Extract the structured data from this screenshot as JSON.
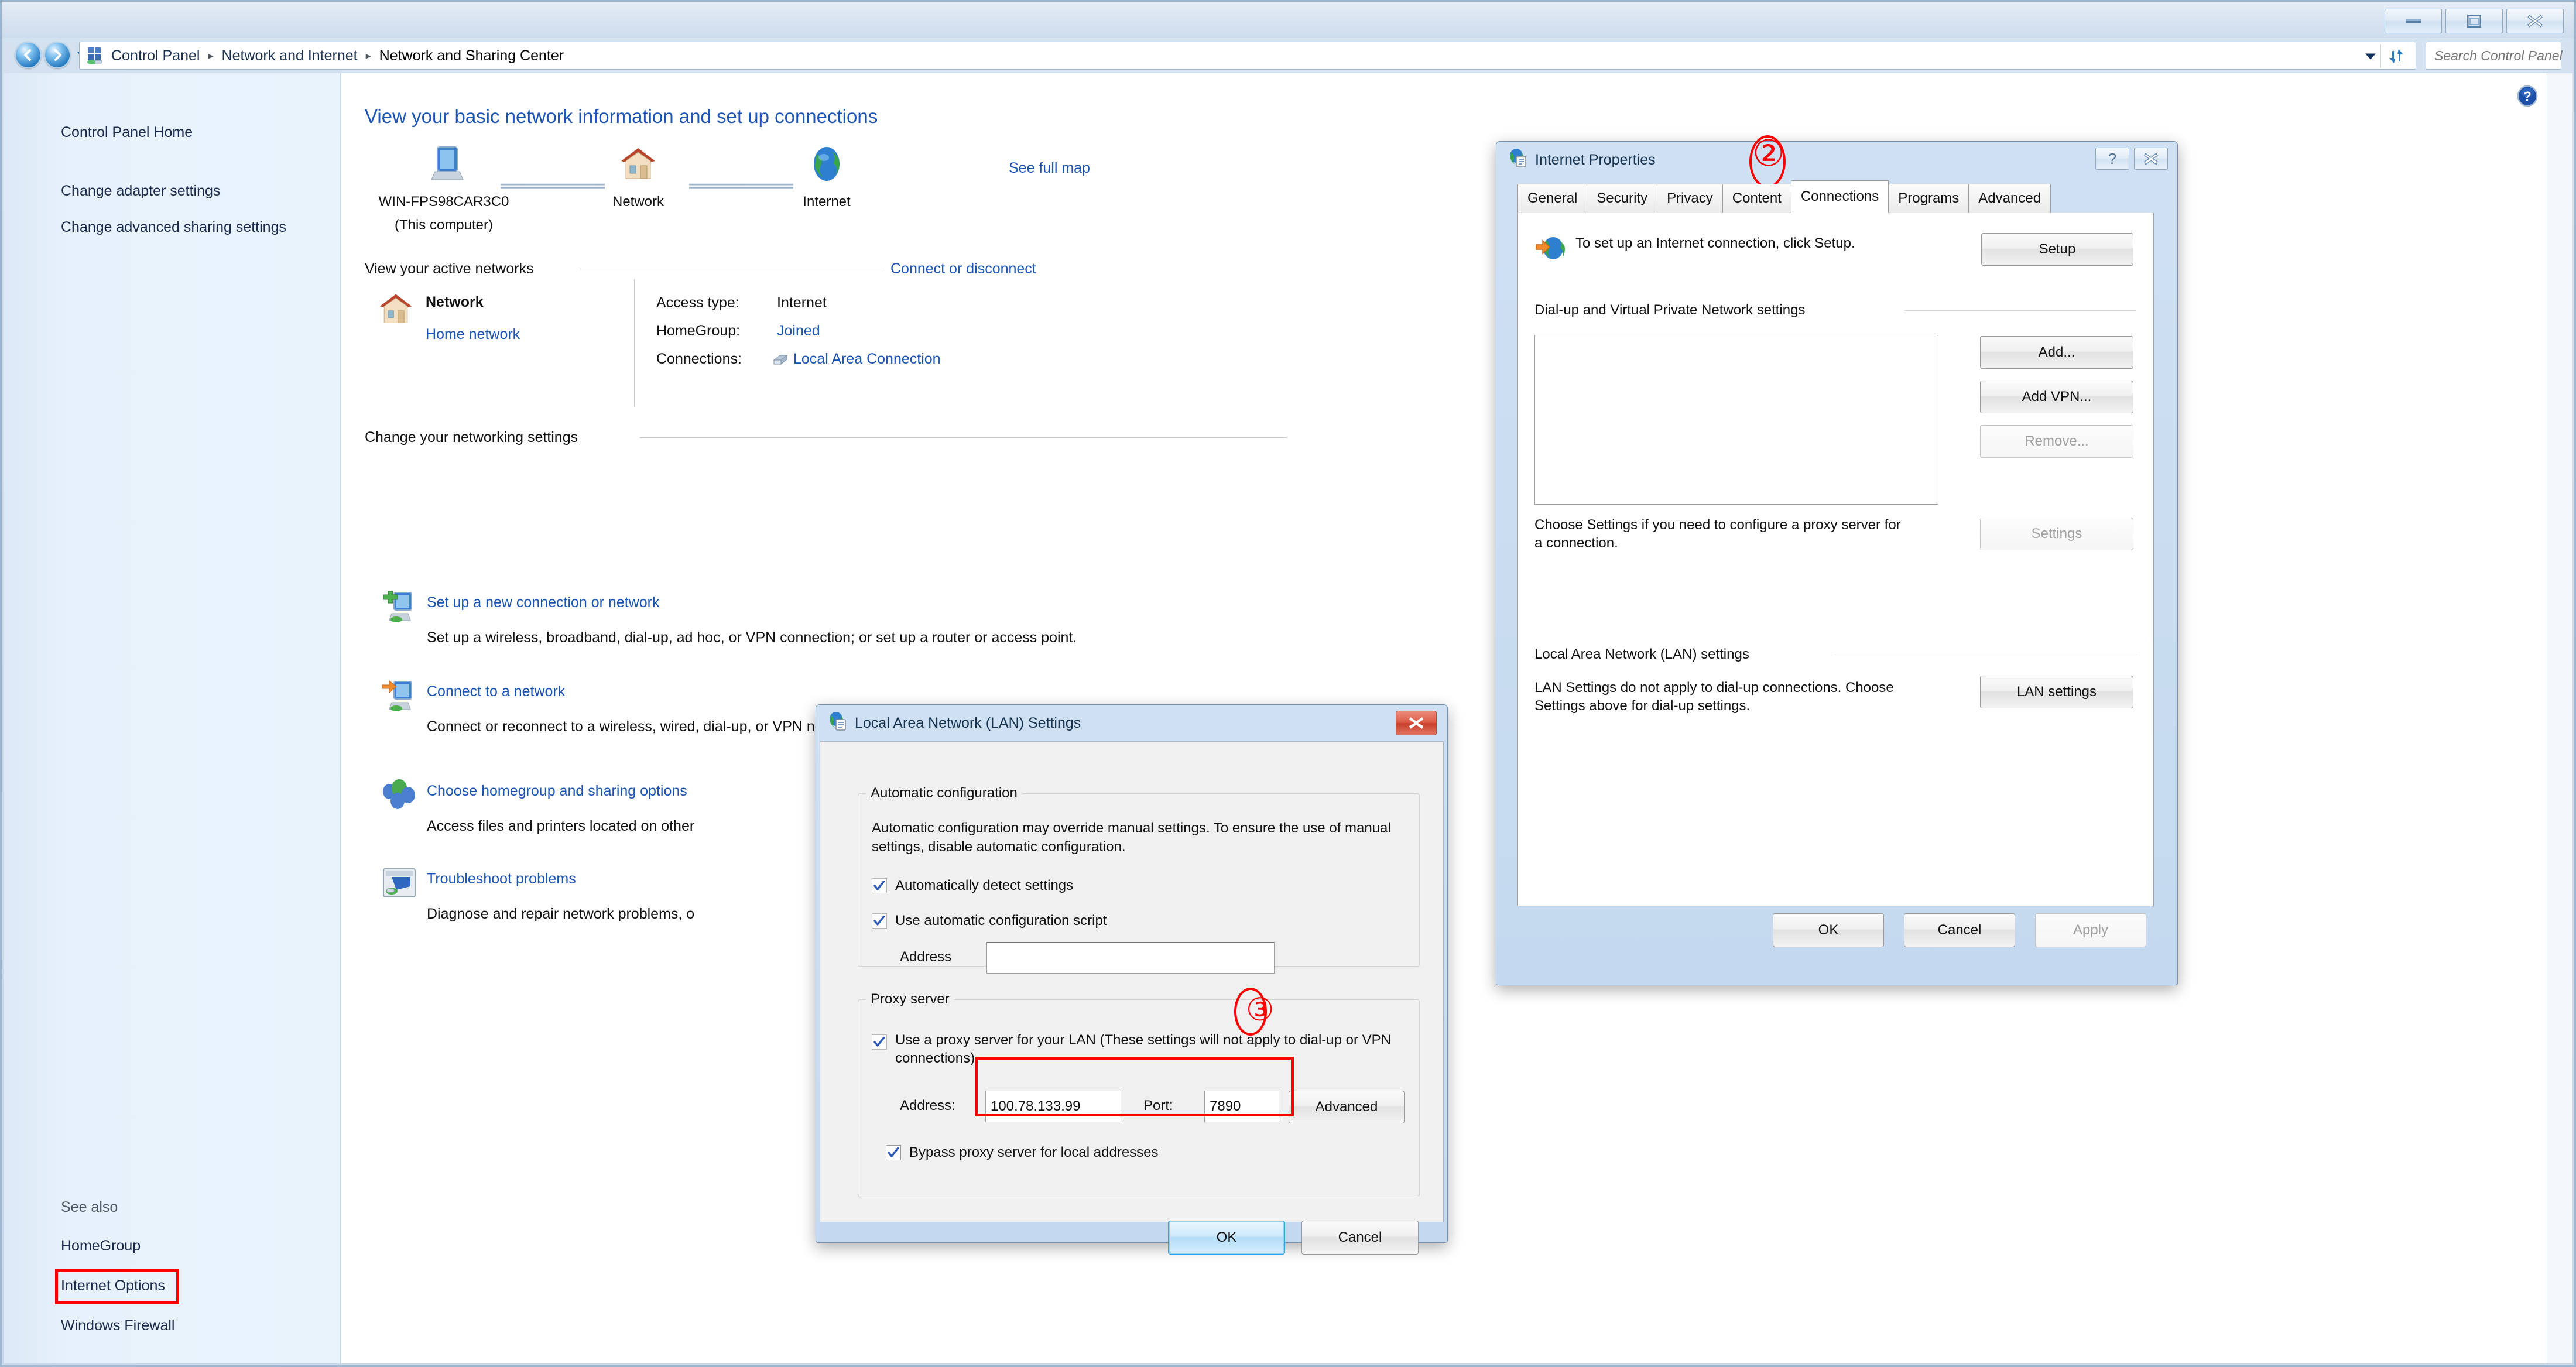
{
  "window": {
    "minimize_label": "Minimize",
    "maximize_label": "Maximize",
    "close_label": "Close"
  },
  "nav": {
    "back_label": "Back",
    "forward_label": "Forward",
    "recent_label": "Recent pages",
    "refresh_label": "Refresh"
  },
  "breadcrumb": {
    "items": [
      "Control Panel",
      "Network and Internet",
      "Network and Sharing Center"
    ],
    "separator": "▸"
  },
  "search": {
    "placeholder": "Search Control Panel",
    "value": ""
  },
  "sidebar": {
    "items": [
      {
        "label": "Control Panel Home"
      },
      {
        "label": "Change adapter settings"
      },
      {
        "label": "Change advanced sharing settings"
      }
    ],
    "see_also_heading": "See also",
    "see_also_items": [
      {
        "label": "HomeGroup",
        "highlighted": false
      },
      {
        "label": "Internet Options",
        "highlighted": true
      },
      {
        "label": "Windows Firewall",
        "highlighted": false
      }
    ]
  },
  "content": {
    "page_title": "View your basic network information and set up connections",
    "help_label": "Help",
    "map": {
      "nodes": [
        {
          "label": "WIN-FPS98CAR3C0",
          "sublabel": "(This computer)",
          "icon": "computer-icon"
        },
        {
          "label": "Network",
          "sublabel": "",
          "icon": "house-icon"
        },
        {
          "label": "Internet",
          "sublabel": "",
          "icon": "globe-icon"
        }
      ],
      "see_full_map": "See full map"
    },
    "active_networks": {
      "heading": "View your active networks",
      "connect_link": "Connect or disconnect",
      "network_name": "Network",
      "network_type_link": "Home network",
      "details": [
        {
          "key": "Access type:",
          "value": "Internet",
          "is_link": false
        },
        {
          "key": "HomeGroup:",
          "value": "Joined",
          "is_link": true
        },
        {
          "key": "Connections:",
          "value": "Local Area Connection",
          "is_link": true
        }
      ]
    },
    "networking_settings": {
      "heading": "Change your networking settings",
      "items": [
        {
          "link": "Set up a new connection or network",
          "desc": "Set up a wireless, broadband, dial-up, ad hoc, or VPN connection; or set up a router or access point.",
          "icon": "new-connection-icon"
        },
        {
          "link": "Connect to a network",
          "desc": "Connect or reconnect to a wireless, wired, dial-up, or VPN network connection.",
          "icon": "connect-network-icon"
        },
        {
          "link": "Choose homegroup and sharing options",
          "desc": "Access files and printers located on other",
          "icon": "homegroup-icon"
        },
        {
          "link": "Troubleshoot problems",
          "desc": "Diagnose and repair network problems, o",
          "icon": "troubleshoot-icon"
        }
      ]
    }
  },
  "internet_properties": {
    "title": "Internet Properties",
    "help_btn": "?",
    "close_btn": "✕",
    "annotation": "②",
    "tabs": [
      {
        "label": "General",
        "active": false
      },
      {
        "label": "Security",
        "active": false
      },
      {
        "label": "Privacy",
        "active": false
      },
      {
        "label": "Content",
        "active": false
      },
      {
        "label": "Connections",
        "active": true
      },
      {
        "label": "Programs",
        "active": false
      },
      {
        "label": "Advanced",
        "active": false
      }
    ],
    "setup_text": "To set up an Internet connection, click Setup.",
    "setup_button": "Setup",
    "dialup_group_label": "Dial-up and Virtual Private Network settings",
    "dialup_list_items": [],
    "add_button": "Add...",
    "add_vpn_button": "Add VPN...",
    "remove_button": "Remove...",
    "settings_button": "Settings",
    "proxy_hint": "Choose Settings if you need to configure a proxy server for a connection.",
    "lan_group_label": "Local Area Network (LAN) settings",
    "lan_hint": "LAN Settings do not apply to dial-up connections. Choose Settings above for dial-up settings.",
    "lan_settings_button": "LAN settings",
    "ok_button": "OK",
    "cancel_button": "Cancel",
    "apply_button": "Apply"
  },
  "lan_settings": {
    "title": "Local Area Network (LAN) Settings",
    "close_btn": "✕",
    "annotation": "③",
    "auto_group_label": "Automatic configuration",
    "auto_desc": "Automatic configuration may override manual settings.  To ensure the use of manual settings, disable automatic configuration.",
    "auto_detect_label": "Automatically detect settings",
    "auto_detect_checked": true,
    "auto_script_label": "Use automatic configuration script",
    "auto_script_checked": true,
    "script_address_label": "Address",
    "script_address_value": "",
    "proxy_group_label": "Proxy server",
    "use_proxy_label": "Use a proxy server for your LAN (These settings will not apply to dial-up or VPN connections).",
    "use_proxy_checked": true,
    "proxy_address_label": "Address:",
    "proxy_address_value": "100.78.133.99",
    "proxy_port_label": "Port:",
    "proxy_port_value": "7890",
    "advanced_button": "Advanced",
    "bypass_label": "Bypass proxy server for local addresses",
    "bypass_checked": true,
    "ok_button": "OK",
    "cancel_button": "Cancel"
  },
  "colors": {
    "link": "#1b54b3",
    "annotation_red": "#ff0000",
    "title_blue": "#1b54b3"
  }
}
